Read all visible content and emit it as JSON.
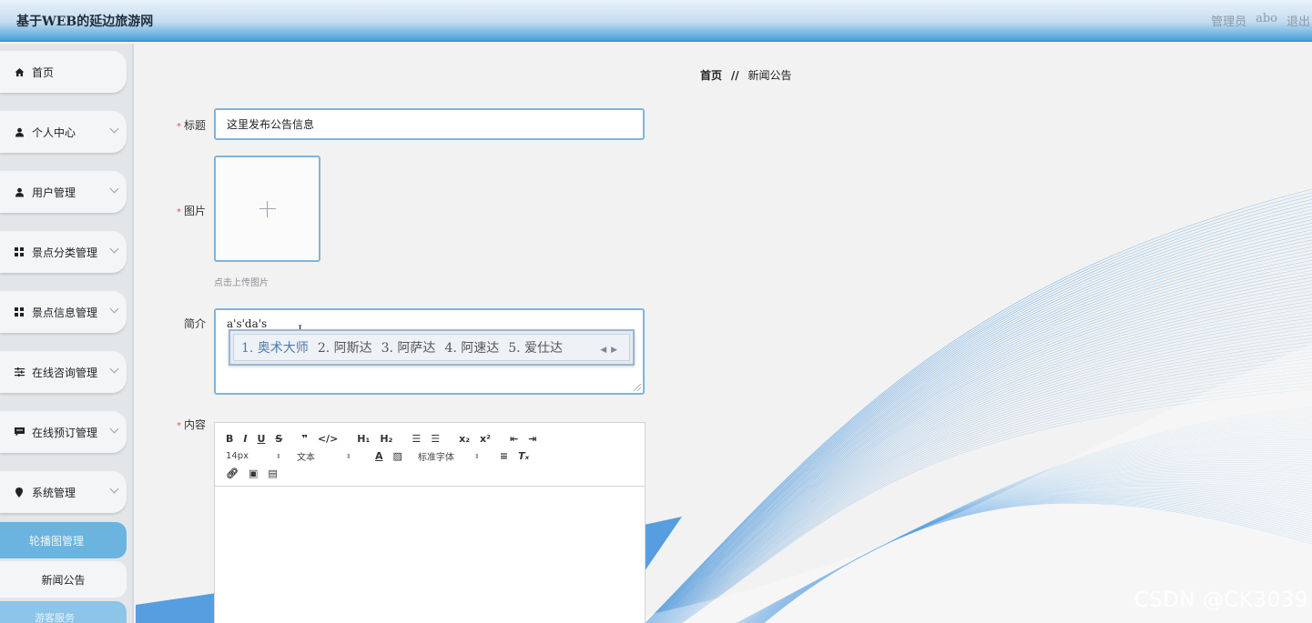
{
  "header": {
    "app_title": "基于WEB的延边旅游网",
    "user_role": "管理员",
    "username": "abo",
    "logout": "退出"
  },
  "sidebar": {
    "items": [
      {
        "label": "首页",
        "icon": "home-icon",
        "has_submenu": false
      },
      {
        "label": "个人中心",
        "icon": "user-icon",
        "has_submenu": true
      },
      {
        "label": "用户管理",
        "icon": "user-icon",
        "has_submenu": true
      },
      {
        "label": "景点分类管理",
        "icon": "grid-icon",
        "has_submenu": true
      },
      {
        "label": "景点信息管理",
        "icon": "grid-icon",
        "has_submenu": true
      },
      {
        "label": "在线咨询管理",
        "icon": "sliders-icon",
        "has_submenu": true
      },
      {
        "label": "在线预订管理",
        "icon": "chat-icon",
        "has_submenu": true
      },
      {
        "label": "系统管理",
        "icon": "pin-icon",
        "has_submenu": true
      }
    ],
    "sub_items": [
      {
        "label": "轮播图管理",
        "state": "active"
      },
      {
        "label": "新闻公告",
        "state": "plain"
      },
      {
        "label": "游客服务",
        "state": "faded"
      }
    ]
  },
  "breadcrumb": {
    "home": "首页",
    "separator": "//",
    "current": "新闻公告"
  },
  "form": {
    "title_label": "标题",
    "title_value": "这里发布公告信息",
    "image_label": "图片",
    "image_hint": "点击上传图片",
    "summary_label": "简介",
    "summary_typed": "a's'da's",
    "content_label": "内容",
    "required_mark": "*"
  },
  "ime": {
    "candidates": [
      "1. 奥术大师",
      "2. 阿斯达",
      "3. 阿萨达",
      "4. 阿速达",
      "5. 爱仕达"
    ],
    "nav": "◀ ▶"
  },
  "editor_toolbar": {
    "row1": [
      "B",
      "I",
      "U",
      "S",
      "99",
      "</>",
      "H1",
      "H2",
      "ol",
      "ul",
      "x2",
      "x²",
      "outdent",
      "indent"
    ],
    "font_size": "14px",
    "text_style": "文本",
    "font_family": "标准字体",
    "row3": [
      "link",
      "image",
      "video"
    ]
  },
  "watermark": "CSDN @CK3039",
  "colors": {
    "accent": "#3b97d8",
    "active_submenu": "#6cb4e0",
    "input_border": "#7fb5d9",
    "required": "#e05050"
  }
}
